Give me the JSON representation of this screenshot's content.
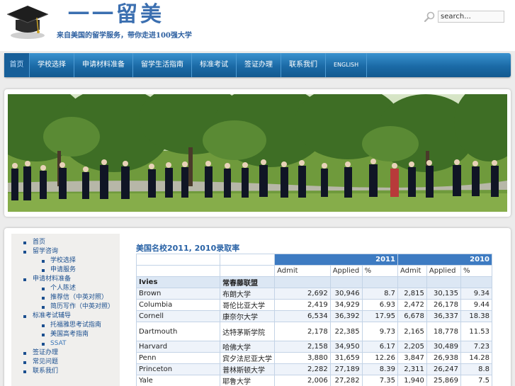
{
  "header": {
    "logo_title": "一一留美",
    "slogan": "来自美国的留学服务，带你走进100强大学",
    "search_placeholder": "search..."
  },
  "nav": {
    "items": [
      "首页",
      "学校选择",
      "申请材料准备",
      "留学生活指南",
      "标准考试",
      "签证办理",
      "联系我们",
      "ENGLISH"
    ]
  },
  "sidebar": {
    "items": [
      {
        "label": "首页",
        "level": 1
      },
      {
        "label": "留学咨询",
        "level": 1
      },
      {
        "label": "学校选择",
        "level": 2
      },
      {
        "label": "申请服务",
        "level": 2
      },
      {
        "label": "申请材料准备",
        "level": 1
      },
      {
        "label": "个人陈述",
        "level": 2
      },
      {
        "label": "推荐信（中英对照）",
        "level": 2
      },
      {
        "label": "简历写作（中英对照）",
        "level": 2
      },
      {
        "label": "标准考试辅导",
        "level": 1
      },
      {
        "label": "托福雅思考试指南",
        "level": 2
      },
      {
        "label": "美国高考指南",
        "level": 2
      },
      {
        "label": "SSAT",
        "level": 2
      },
      {
        "label": "签证办理",
        "level": 1
      },
      {
        "label": "常见问题",
        "level": 1
      },
      {
        "label": "联系我们",
        "level": 1
      }
    ]
  },
  "main": {
    "title": "美国名校2011, 2010录取率",
    "years": [
      "2011",
      "2010"
    ],
    "subheaders": [
      "Admit",
      "Applied",
      "%",
      "Admit",
      "Applied",
      "%"
    ],
    "group": {
      "name": "Ivies",
      "cn": "常春藤联盟"
    },
    "rows": [
      {
        "name": "Brown",
        "cn": "布朗大学",
        "v": [
          "2,692",
          "30,946",
          "8.7",
          "2,815",
          "30,135",
          "9.34"
        ]
      },
      {
        "name": "Columbia",
        "cn": "哥伦比亚大学",
        "v": [
          "2,419",
          "34,929",
          "6.93",
          "2,472",
          "26,178",
          "9.44"
        ]
      },
      {
        "name": "Cornell",
        "cn": "康奈尔大学",
        "v": [
          "6,534",
          "36,392",
          "17.95",
          "6,678",
          "36,337",
          "18.38"
        ]
      },
      {
        "name": "Dartmouth",
        "cn": "达特茅斯学院",
        "v": [
          "2,178",
          "22,385",
          "9.73",
          "2,165",
          "18,778",
          "11.53"
        ]
      },
      {
        "name": "Harvard",
        "cn": "哈佛大学",
        "v": [
          "2,158",
          "34,950",
          "6.17",
          "2,205",
          "30,489",
          "7.23"
        ]
      },
      {
        "name": "Penn",
        "cn": "宾夕法尼亚大学",
        "v": [
          "3,880",
          "31,659",
          "12.26",
          "3,847",
          "26,938",
          "14.28"
        ]
      },
      {
        "name": "Princeton",
        "cn": "普林斯顿大学",
        "v": [
          "2,282",
          "27,189",
          "8.39",
          "2,311",
          "26,247",
          "8.8"
        ]
      },
      {
        "name": "Yale",
        "cn": "耶鲁大学",
        "v": [
          "2,006",
          "27,282",
          "7.35",
          "1,940",
          "25,869",
          "7.5"
        ]
      }
    ]
  }
}
